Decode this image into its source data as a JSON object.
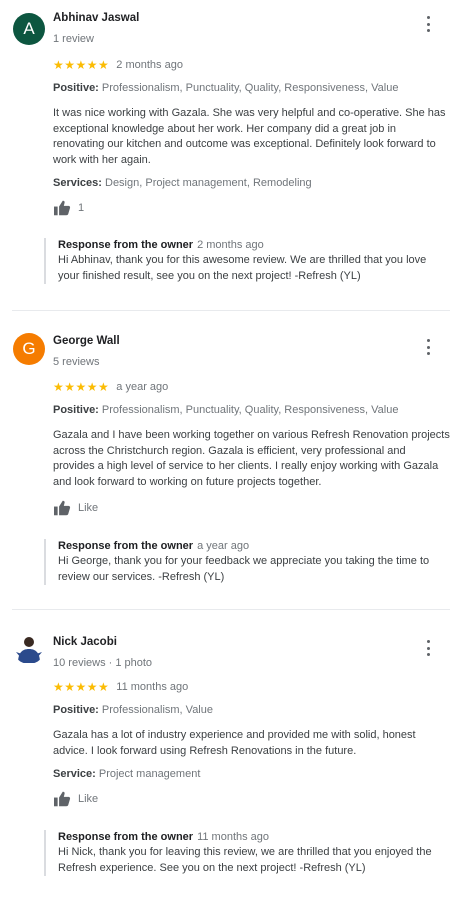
{
  "reviews": [
    {
      "avatar_letter": "A",
      "avatar_color": "#0d5640",
      "name": "Abhinav Jaswal",
      "review_count": "1 review",
      "stars": "★★★★★",
      "date": "2 months ago",
      "positive_label": "Positive:",
      "positive_values": "Professionalism, Punctuality, Quality, Responsiveness, Value",
      "text": "It was nice working with Gazala. She was very helpful and co-operative. She has exceptional knowledge about her work. Her company did a great job in renovating our kitchen and outcome was exceptional. Definitely look forward to work with her again.",
      "services_label": "Services:",
      "services_values": "Design, Project management, Remodeling",
      "like_label": "1",
      "owner_label": "Response from the owner",
      "owner_date": "2 months ago",
      "owner_text": "Hi Abhinav, thank you for this awesome review. We are thrilled that you love your finished result, see you on the next project! -Refresh (YL)"
    },
    {
      "avatar_letter": "G",
      "avatar_color": "#f57c00",
      "name": "George Wall",
      "review_count": "5 reviews",
      "stars": "★★★★★",
      "date": "a year ago",
      "positive_label": "Positive:",
      "positive_values": "Professionalism, Punctuality, Quality, Responsiveness, Value",
      "text": "Gazala and I have been working together on various Refresh Renovation projects across the Christchurch region. Gazala is efficient,  very professional and provides a high level of service to her clients. I really enjoy working with Gazala and look forward to working on future projects together.",
      "like_label": "Like",
      "owner_label": "Response from the owner",
      "owner_date": "a year ago",
      "owner_text": "Hi George, thank you for your feedback we appreciate you taking the time to review our services. -Refresh (YL)"
    },
    {
      "name": "Nick Jacobi",
      "review_count": "10 reviews · 1 photo",
      "stars": "★★★★★",
      "date": "11 months ago",
      "positive_label": "Positive:",
      "positive_values": "Professionalism, Value",
      "text": "Gazala has a lot of industry experience and provided me with solid, honest advice. I look forward using Refresh Renovations in the future.",
      "services_label": "Service:",
      "services_values": "Project management",
      "like_label": "Like",
      "owner_label": "Response from the owner",
      "owner_date": "11 months ago",
      "owner_text": "Hi Nick, thank you for leaving this review, we are thrilled that you enjoyed the Refresh experience. See you on the next project! -Refresh (YL)"
    }
  ],
  "icons": {
    "more": "more-vertical-icon",
    "like": "thumbs-up-icon"
  },
  "colors": {
    "star": "#fbbc04",
    "secondary_text": "#70757a",
    "body_text": "#3c4043"
  }
}
